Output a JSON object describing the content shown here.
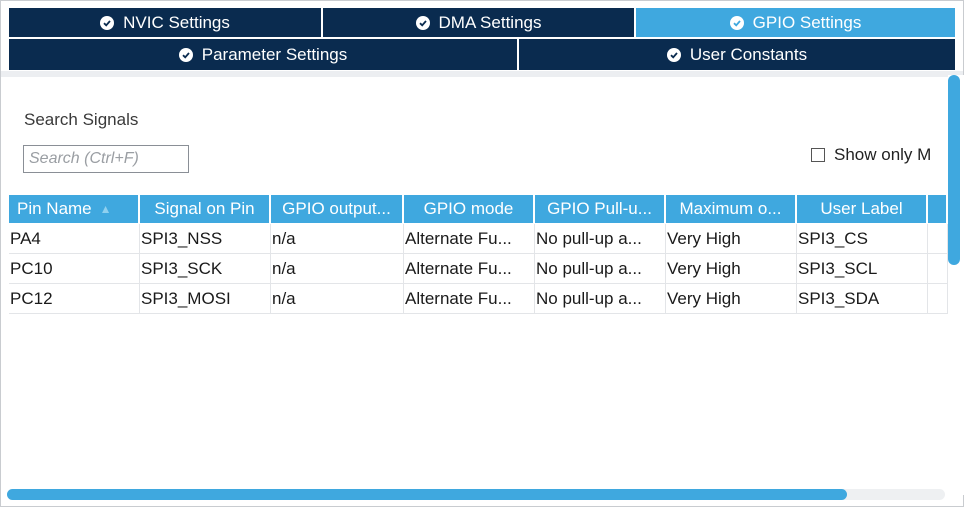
{
  "tabs_row1": [
    {
      "label": "NVIC Settings",
      "active": false
    },
    {
      "label": "DMA Settings",
      "active": false
    },
    {
      "label": "GPIO Settings",
      "active": true
    }
  ],
  "tabs_row2": [
    {
      "label": "Parameter Settings",
      "active": false
    },
    {
      "label": "User Constants",
      "active": false
    }
  ],
  "search": {
    "label": "Search Signals",
    "placeholder": "Search (Ctrl+F)",
    "value": ""
  },
  "filter": {
    "show_only_label": "Show only M",
    "checked": false
  },
  "table": {
    "columns": [
      "Pin Name",
      "Signal on Pin",
      "GPIO output...",
      "GPIO mode",
      "GPIO Pull-u...",
      "Maximum o...",
      "User Label"
    ],
    "rows": [
      [
        "PA4",
        "SPI3_NSS",
        "n/a",
        "Alternate Fu...",
        "No pull-up a...",
        "Very High",
        "SPI3_CS"
      ],
      [
        "PC10",
        "SPI3_SCK",
        "n/a",
        "Alternate Fu...",
        "No pull-up a...",
        "Very High",
        "SPI3_SCL"
      ],
      [
        "PC12",
        "SPI3_MOSI",
        "n/a",
        "Alternate Fu...",
        "No pull-up a...",
        "Very High",
        "SPI3_SDA"
      ]
    ]
  },
  "colors": {
    "tab_dark": "#0a2b4f",
    "accent": "#3fa8df"
  }
}
